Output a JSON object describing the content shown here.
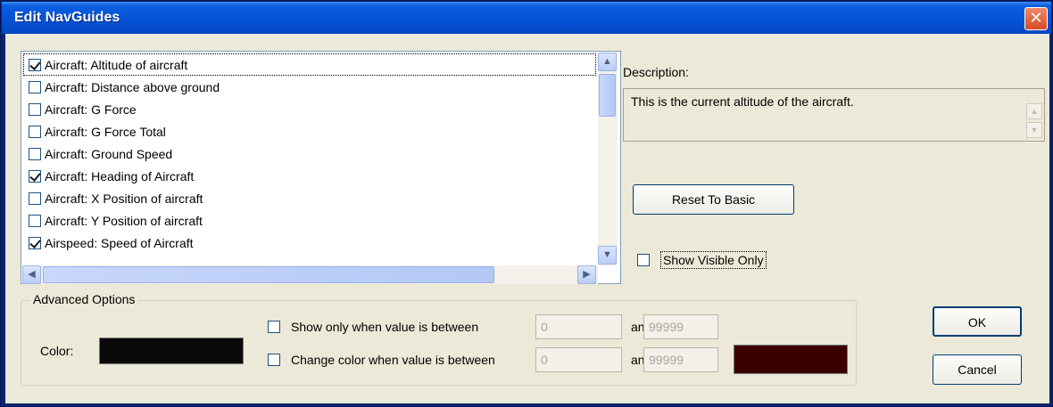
{
  "window": {
    "title": "Edit NavGuides",
    "close_glyph": "✕"
  },
  "list": {
    "items": [
      {
        "label": "Aircraft: Altitude of aircraft",
        "checked": true
      },
      {
        "label": "Aircraft: Distance above ground",
        "checked": false
      },
      {
        "label": "Aircraft: G Force",
        "checked": false
      },
      {
        "label": "Aircraft: G Force Total",
        "checked": false
      },
      {
        "label": "Aircraft: Ground Speed",
        "checked": false
      },
      {
        "label": "Aircraft: Heading of Aircraft",
        "checked": true
      },
      {
        "label": "Aircraft: X Position of aircraft",
        "checked": false
      },
      {
        "label": "Aircraft: Y Position of aircraft",
        "checked": false
      },
      {
        "label": "Airspeed: Speed of Aircraft",
        "checked": true
      }
    ],
    "scroll_up_glyph": "▲",
    "scroll_down_glyph": "▼",
    "scroll_left_glyph": "◀",
    "scroll_right_glyph": "▶"
  },
  "description": {
    "label": "Description:",
    "text": "This is the current altitude of the aircraft."
  },
  "reset_button": {
    "label": "Reset To Basic"
  },
  "show_visible_only": {
    "label": "Show Visible Only",
    "checked": false
  },
  "advanced": {
    "legend": "Advanced Options",
    "color_label": "Color:",
    "color": "#0a0a0a",
    "show_only": {
      "label": "Show only when value is between",
      "checked": false,
      "min": "0",
      "and_label": "and",
      "max": "99999"
    },
    "change_color": {
      "label": "Change color when value is between",
      "checked": false,
      "min": "0",
      "and_label": "and",
      "max": "99999",
      "color": "#3a0000"
    }
  },
  "ok_button": {
    "label": "OK"
  },
  "cancel_button": {
    "label": "Cancel"
  }
}
